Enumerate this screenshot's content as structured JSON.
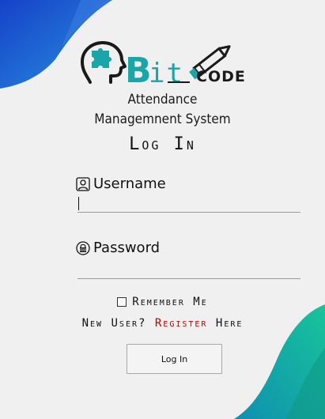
{
  "logo": {
    "word_bit": "Bit",
    "word_code": "CODE",
    "icons": [
      "brain-puzzle-icon",
      "pencil-icon"
    ]
  },
  "subtitle": {
    "line1": "Attendance",
    "line2": "Managemnent System"
  },
  "form": {
    "title": "Log In",
    "username_label": "Username",
    "username_value": "",
    "password_label": "Password",
    "password_value": "",
    "remember_label": "Remember Me",
    "remember_checked": false,
    "new_user_prefix": "New User?",
    "register_label": "Register",
    "new_user_suffix": "Here",
    "login_button": "Log In"
  },
  "colors": {
    "background": "#f0f0f0",
    "top_wave": "#1f4fd0",
    "bottom_wave": "#10b3a0",
    "logo_teal": "#1aa6a8",
    "register_link": "#c40000"
  }
}
